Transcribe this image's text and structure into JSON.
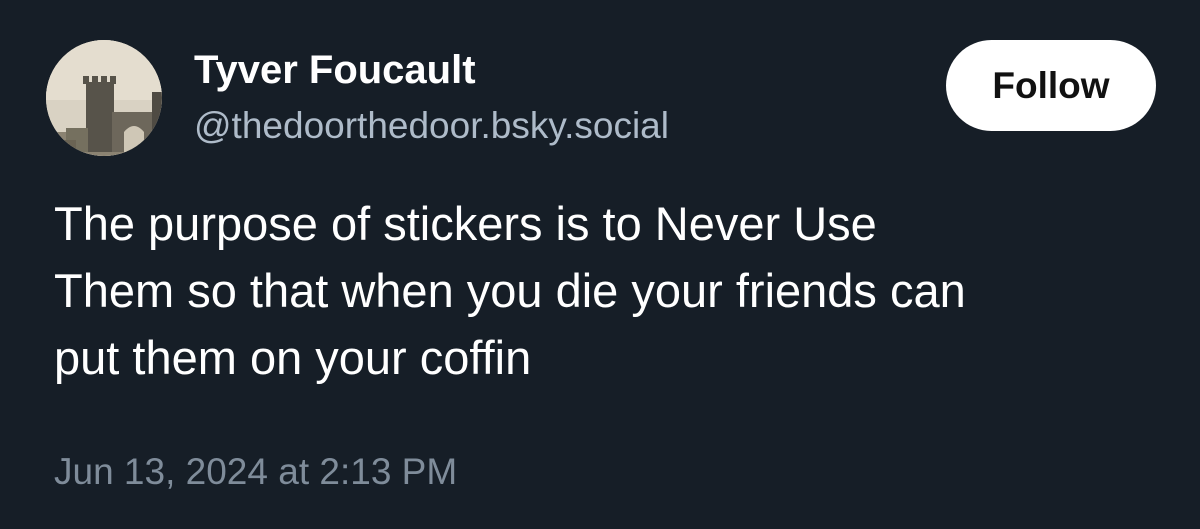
{
  "author": {
    "display_name": "Tyver Foucault",
    "handle": "@thedoorthedoor.bsky.social",
    "avatar_icon": "castle-photo-avatar"
  },
  "follow_button": {
    "label": "Follow"
  },
  "post": {
    "text_lines": [
      "The purpose of stickers is to Never Use",
      "Them so that when you die your friends can",
      "put them on your coffin"
    ],
    "timestamp": "Jun 13, 2024 at 2:13 PM"
  },
  "colors": {
    "background": "#161e27",
    "text": "#ffffff",
    "handle": "#aebbc9",
    "timestamp": "#7f8c9a",
    "button_bg": "#ffffff",
    "button_text": "#111111"
  }
}
